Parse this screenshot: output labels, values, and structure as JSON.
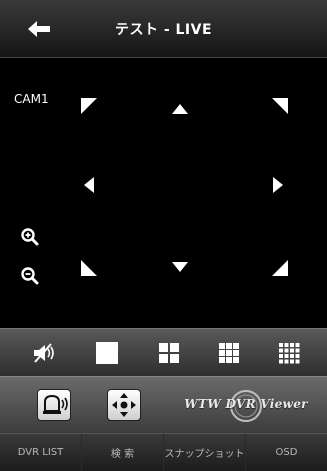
{
  "header": {
    "title": "テスト - LIVE"
  },
  "viewport": {
    "camera_label": "CAM1"
  },
  "layout_bar": {
    "buttons": [
      "mute",
      "layout-1",
      "layout-4",
      "layout-9",
      "layout-16"
    ]
  },
  "control_bar": {
    "brand_text": "WTW DVR Viewer"
  },
  "tabs": [
    {
      "label": "DVR LIST"
    },
    {
      "label": "検 索"
    },
    {
      "label": "スナップショット"
    },
    {
      "label": "OSD"
    }
  ],
  "colors": {
    "background": "#000000",
    "toolbar": "#4a4a4a",
    "tab_text": "#b8b8b8"
  }
}
